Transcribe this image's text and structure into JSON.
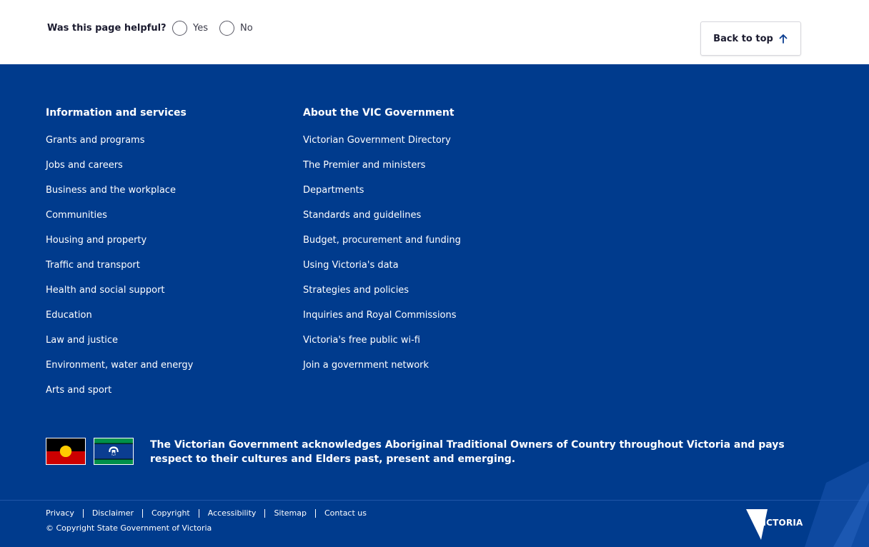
{
  "feedback": {
    "question": "Was this page helpful?",
    "options": [
      "Yes",
      "No"
    ]
  },
  "back_to_top": {
    "label": "Back to top",
    "icon": "arrow-up-icon"
  },
  "footer": {
    "columns": [
      {
        "heading": "Information and services",
        "links": [
          "Grants and programs",
          "Jobs and careers",
          "Business and the workplace",
          "Communities",
          "Housing and property",
          "Traffic and transport",
          "Health and social support",
          "Education",
          "Law and justice",
          "Environment, water and energy",
          "Arts and sport"
        ]
      },
      {
        "heading": "About the VIC Government",
        "links": [
          "Victorian Government Directory",
          "The Premier and ministers",
          "Departments",
          "Standards and guidelines",
          "Budget, procurement and funding",
          "Using Victoria's data",
          "Strategies and policies",
          "Inquiries and Royal Commissions",
          "Victoria's free public wi-fi",
          "Join a government network"
        ]
      }
    ],
    "acknowledgement": "The Victorian Government acknowledges Aboriginal Traditional Owners of Country throughout Victoria and pays respect to their cultures and Elders past, present and emerging.",
    "flags": [
      "aboriginal-flag",
      "torres-strait-islander-flag"
    ],
    "bottom_links": [
      "Privacy",
      "Disclaimer",
      "Copyright",
      "Accessibility",
      "Sitemap",
      "Contact us"
    ],
    "copyright": "© Copyright State Government of Victoria",
    "logo_text": "VICTORIA"
  },
  "colors": {
    "footer_bg": "#003b8d",
    "text_on_footer": "#ffffff",
    "aboriginal_black": "#000000",
    "aboriginal_red": "#cc0000",
    "aboriginal_yellow": "#ffcc00",
    "torres_green": "#00904a",
    "torres_blue": "#0b3d91"
  }
}
